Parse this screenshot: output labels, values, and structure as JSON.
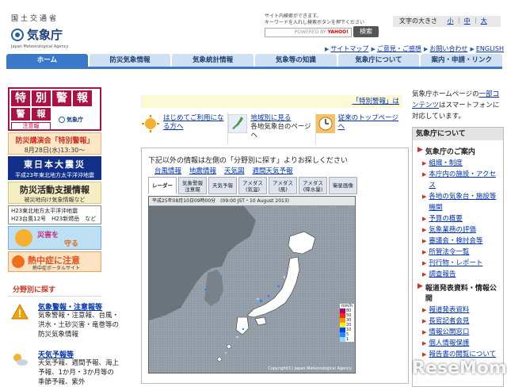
{
  "header": {
    "agency_jp_top": "国土交通省",
    "agency_name": "気象庁",
    "agency_en": "Japan Meteorological Agency",
    "search_note_1": "サイト内検索ができます。",
    "search_note_2": "キーワードを入れし検索ボタンを押下ください",
    "search_powered": "POWERED BY",
    "search_yahoo": "YAHOO!",
    "search_button": "検索",
    "fontsize_label": "文字の大きさ",
    "fontsize_small": "小",
    "fontsize_medium": "中",
    "fontsize_large": "大",
    "util_links": [
      "サイトマップ",
      "ご意見・ご感想",
      "お問い合わせ",
      "ENGLISH"
    ]
  },
  "nav": [
    "ホーム",
    "防災気象情報",
    "気象統計情報",
    "気象等の知識",
    "気象庁について",
    "案内・申請・リンク"
  ],
  "left": {
    "warning_chars_1": [
      "特",
      "別",
      "警",
      "報"
    ],
    "warning_chars_2": [
      "警",
      "報"
    ],
    "warning_small": "注意報",
    "warning_agency": "気象庁",
    "lecture_1": "防災講演会「特別警報」",
    "lecture_2": "8月28日(水)13:30～",
    "quake_1": "東日本大震災",
    "quake_2": "平成23年東北地方太平洋沖地震",
    "support_1": "防災活動支援情報",
    "support_2": "被災地向け気象情報など",
    "h23_1": "H23東北地方太平洋沖地震",
    "h23_2": "H23台風12号　H23新燃岳　など",
    "cute_text": "災害を",
    "cute_text_2": "守る",
    "heat_1": "熱中症に注意",
    "heat_2": "熱中症ポータルサイト",
    "category_heading": "分野別に探す",
    "categories": [
      {
        "title": "気象警報・注意報等",
        "desc": "気象警報・注意報、台風・洪水・土砂災害・竜巻等の防災気象情報"
      },
      {
        "title": "天気予報等",
        "desc": "天気予報、週間予報、海上予報、1か月・3か月等の季節予報、紫外"
      }
    ]
  },
  "center": {
    "breaking_link": "「特別警報」は",
    "features": [
      {
        "title": "はじめてご利用になる方へ",
        "sub": ""
      },
      {
        "title": "地域別に見る",
        "sub": "各地気象台のページへ"
      },
      {
        "title": "従来のトップページへ",
        "sub": ""
      }
    ],
    "panel_title": "下記以外の情報は左側の「分野別に探す」よりお探しください",
    "panel_links": [
      "台風情報",
      "地震情報",
      "天気図",
      "週間天気予報"
    ],
    "map_tabs": [
      "レーダー",
      "気象警報\n注意報",
      "天気予報",
      "アメダス\n(気温)",
      "アメダス\n(風)",
      "アメダス\n(降水量)",
      "衛星画像"
    ],
    "map_caption": "平成25年08月10日09時00分　(09:00 JST・10 August 2013)",
    "map_copyright": "Copyright(C) Japan Meteorological Agency",
    "legend_title": "mm/h",
    "legend": [
      {
        "label": "80",
        "color": "#b4006e"
      },
      {
        "label": "50",
        "color": "#ff2800"
      },
      {
        "label": "30",
        "color": "#ff9900"
      },
      {
        "label": "20",
        "color": "#faf500"
      },
      {
        "label": "10",
        "color": "#0041ff"
      },
      {
        "label": "5",
        "color": "#218cff"
      },
      {
        "label": "1",
        "color": "#a0d2ff"
      }
    ]
  },
  "right": {
    "intro_1": "気象庁ホームページの",
    "intro_link": "一部コンテンツ",
    "intro_2": "はスマートフォンに対応しています。",
    "box_head": "気象庁について",
    "section_1": "気象庁のご案内",
    "items_1": [
      "組織・制度",
      "本庁内の施設・アクセス",
      "各地の気象台・施設等機関",
      "予算の概要",
      "気象業務の評価",
      "審議会・検討会等",
      "所管法令一覧",
      "刊行物・レポート",
      "調査報告"
    ],
    "section_2": "報道発表資料・情報公開",
    "items_2": [
      "報道発表資料",
      "長官記者会見",
      "情報公開窓口",
      "個人情報保護",
      "報告書の閲覧について"
    ]
  },
  "watermark": "ReseMom"
}
